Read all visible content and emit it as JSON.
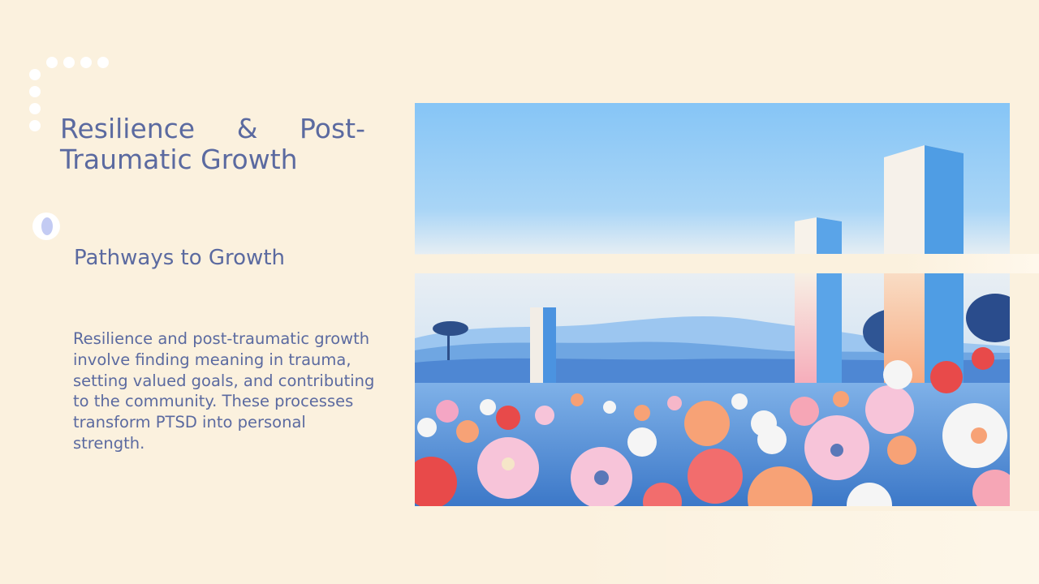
{
  "slide": {
    "title_line1_words": [
      "Resilience",
      "&",
      "Post-"
    ],
    "title_line2": "Traumatic Growth",
    "subtitle": "Pathways to Growth",
    "body": "Resilience and post-traumatic growth involve finding meaning in trauma, setting valued goals, and contributing to the community. These processes transform PTSD into personal strength."
  },
  "colors": {
    "background": "#fbf1de",
    "text": "#5b6aa0",
    "sky": "#86c5f6",
    "accent_ring": "#c3cbf3"
  },
  "icons": [
    "decorative-dot-icon",
    "ring-bullet-icon"
  ]
}
